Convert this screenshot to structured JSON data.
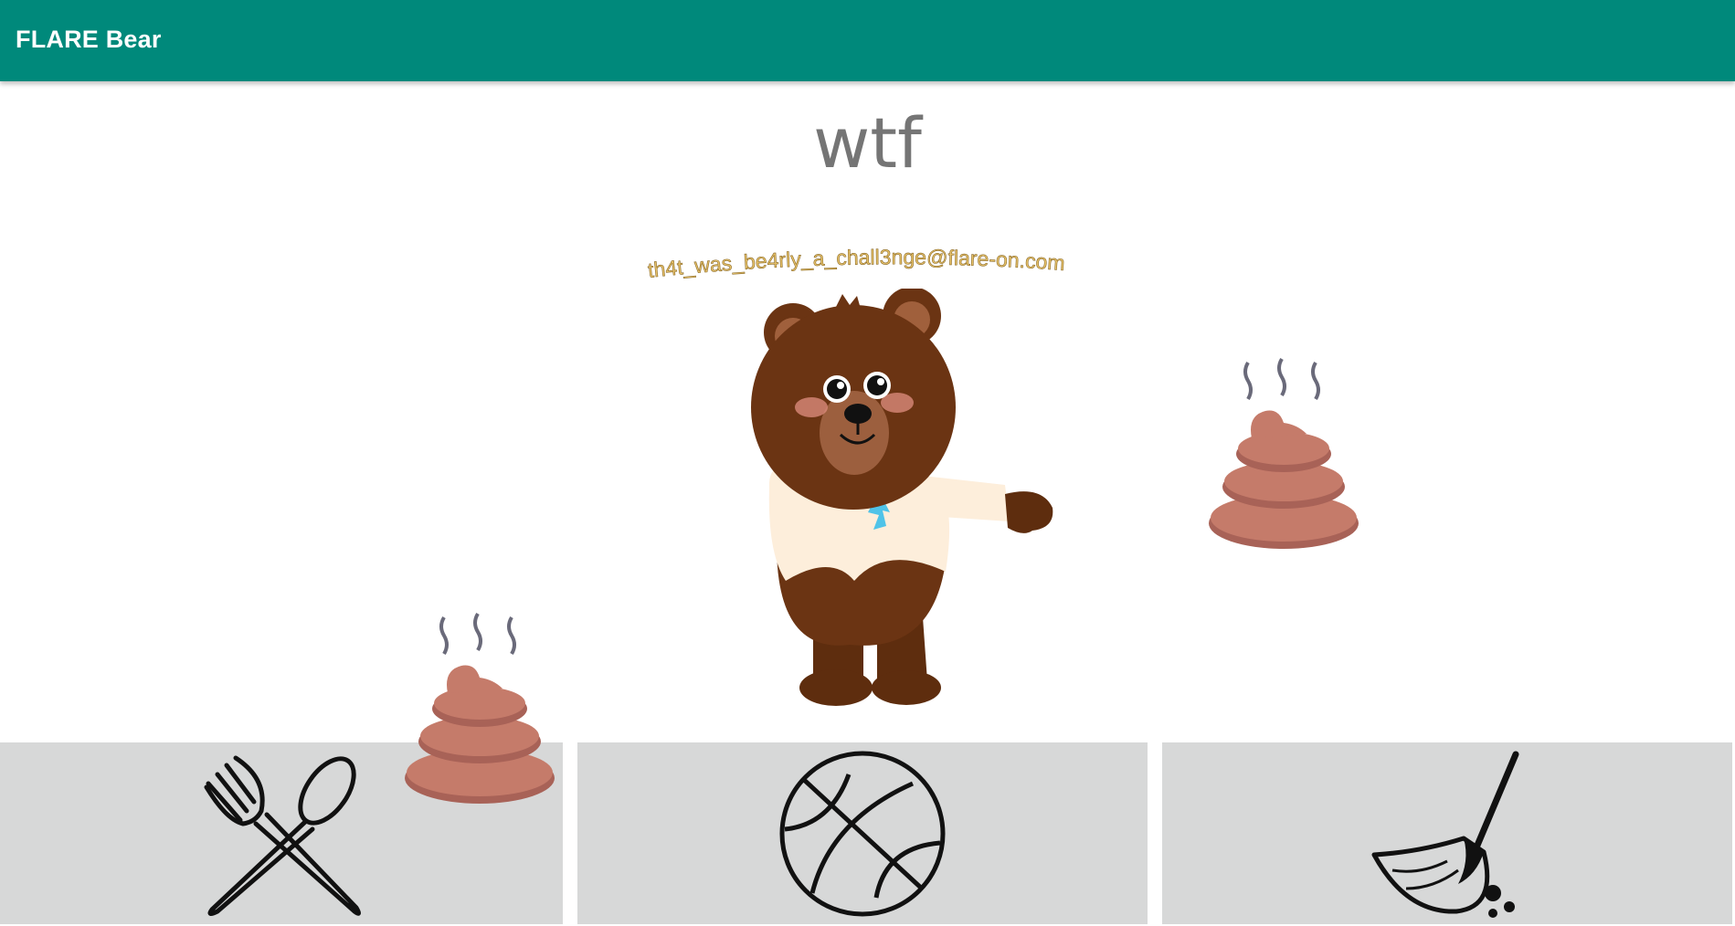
{
  "app_bar": {
    "title": "FLARE Bear"
  },
  "bear": {
    "mood_text": "wtf",
    "flag_text": "th4t_was_be4rly_a_chall3nge@flare-on.com"
  },
  "actions": {
    "feed_icon": "fork-spoon-icon",
    "play_icon": "basketball-icon",
    "clean_icon": "broom-icon"
  },
  "colors": {
    "app_bar": "#00897b",
    "button_bg": "#d7d8d8",
    "bear_brown": "#6b3413",
    "flag_gold": "#e8c36a"
  }
}
